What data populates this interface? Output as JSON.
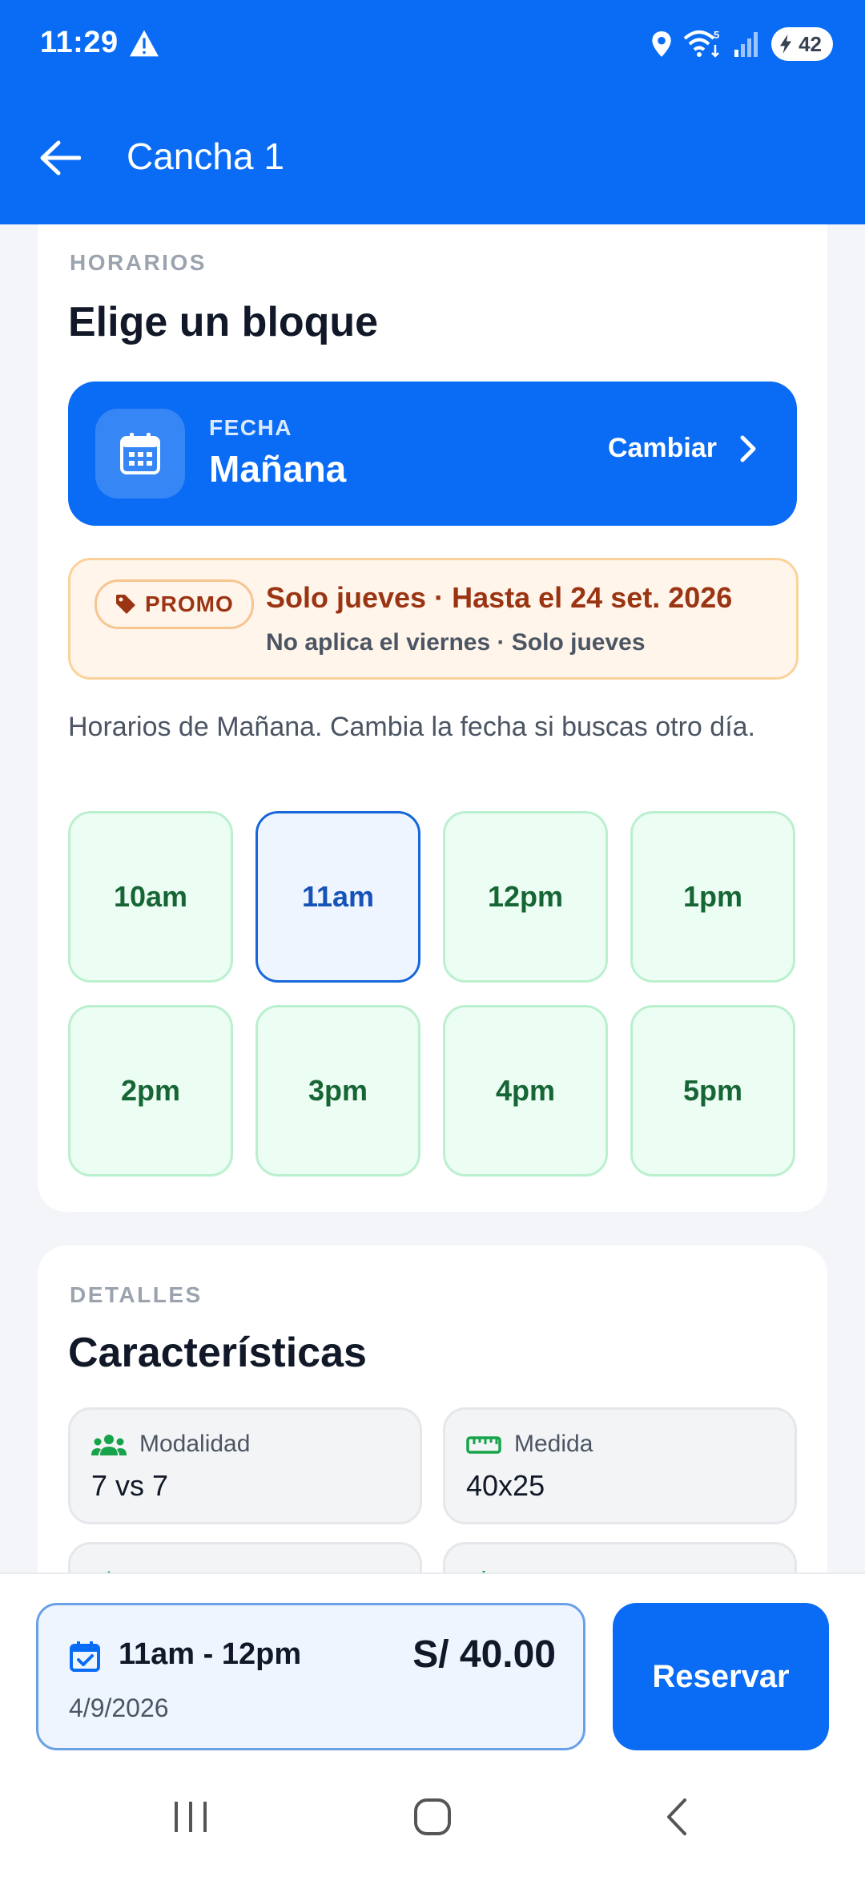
{
  "status_bar": {
    "time": "11:29",
    "battery": "42",
    "wifi_badge": "5"
  },
  "toolbar": {
    "title": "Cancha 1"
  },
  "schedule": {
    "overline": "HORARIOS",
    "heading": "Elige un bloque",
    "date": {
      "label": "FECHA",
      "value": "Mañana",
      "change_label": "Cambiar"
    },
    "promo": {
      "badge": "PROMO",
      "title": "Solo jueves · Hasta el 24 set. 2026",
      "subtitle": "No aplica el viernes · Solo jueves"
    },
    "hint": "Horarios de Mañana. Cambia la fecha si buscas otro día.",
    "slots": [
      {
        "label": "10am"
      },
      {
        "label": "11am"
      },
      {
        "label": "12pm"
      },
      {
        "label": "1pm"
      },
      {
        "label": "2pm"
      },
      {
        "label": "3pm"
      },
      {
        "label": "4pm"
      },
      {
        "label": "5pm"
      }
    ],
    "selected_slot": "11am"
  },
  "details": {
    "overline": "DETALLES",
    "heading": "Características",
    "features": [
      {
        "label": "Modalidad",
        "value": "7 vs 7",
        "icon": "group-icon"
      },
      {
        "label": "Medida",
        "value": "40x25",
        "icon": "ruler-icon"
      }
    ]
  },
  "booking": {
    "time_range": "11am - 12pm",
    "price": "S/ 40.00",
    "date": "4/9/2026",
    "reserve_label": "Reservar"
  },
  "colors": {
    "primary": "#0a6cf5",
    "slot_green": "#166534",
    "promo_text": "#9a3412"
  }
}
